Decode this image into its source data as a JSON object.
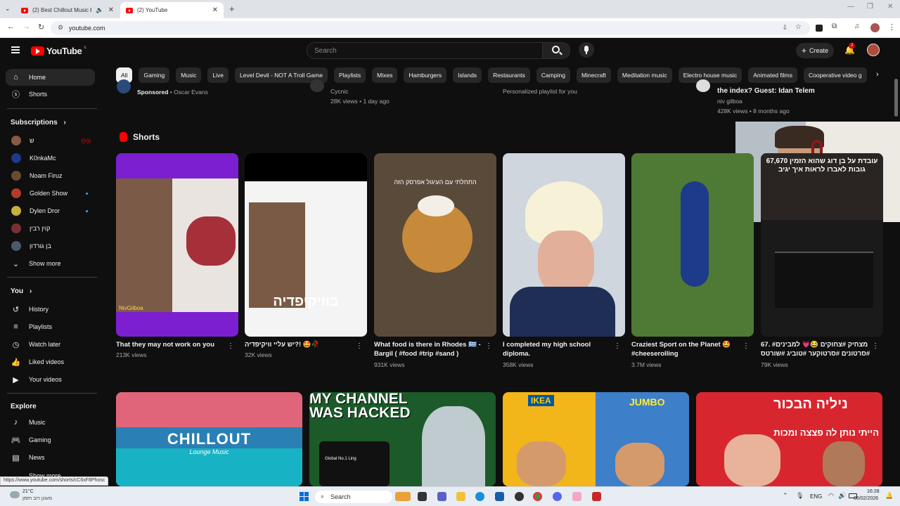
{
  "browser": {
    "tabs": [
      {
        "label": "(2) Best Chillout Music 🎼"
      },
      {
        "label": "(2) YouTube"
      }
    ],
    "url": "youtube.com",
    "status_url": "https://www.youtube.com/shorts/cC6xF8Phosc"
  },
  "masthead": {
    "logo": "YouTube",
    "logo_region": "IL",
    "search_placeholder": "Search",
    "create_label": "Create",
    "notifications_count": "2"
  },
  "chips": [
    "All",
    "Gaming",
    "Music",
    "Live",
    "Level Devil - NOT A Troll Game",
    "Playlists",
    "Mixes",
    "Hamburgers",
    "Islands",
    "Restaurants",
    "Camping",
    "Minecraft",
    "Meditation music",
    "Electro house music",
    "Animated films",
    "Cooperative video g"
  ],
  "sidebar": {
    "home": "Home",
    "shorts": "Shorts",
    "subscriptions_header": "Subscriptions",
    "subscriptions": [
      {
        "name": "ש",
        "color": "#8a5a44"
      },
      {
        "name": "K0nkaMc",
        "color": "#1e3a8a"
      },
      {
        "name": "Noam Firuz",
        "color": "#6b4a2f"
      },
      {
        "name": "Golden Show",
        "color": "#b43a2a"
      },
      {
        "name": "Dylen Dror",
        "color": "#c9b03a"
      },
      {
        "name": "קוין רבין",
        "color": "#7a3030"
      },
      {
        "name": "בן גורדון",
        "color": "#4a5a6a"
      }
    ],
    "show_more": "Show more",
    "you_header": "You",
    "you_items": [
      "History",
      "Playlists",
      "Watch later",
      "Liked videos",
      "Your videos"
    ],
    "explore_header": "Explore",
    "explore_items": [
      "Music",
      "Gaming",
      "News"
    ],
    "show_more_2": "Show more"
  },
  "top_row": [
    {
      "line1": "Sponsored",
      "line2": "Oscar Evans"
    },
    {
      "channel": "Cycnic",
      "meta": "28K views • 1 day ago"
    },
    {
      "meta": "Personalized playlist for you"
    },
    {
      "title": "the index? Guest: Idan Telem",
      "channel": "niv gilboa",
      "meta": "428K views • 8 months ago"
    }
  ],
  "shorts_header": "Shorts",
  "shorts": [
    {
      "title": "That they may not work on you",
      "views": "213K views",
      "bg": "#7b1fd1",
      "overlay": "NivGilboa"
    },
    {
      "title": "יש עליי וויקיפדיה?! 🤩🥀",
      "views": "32K views",
      "bg": "#f4f4f4",
      "overlay": "בוויקיפדיה"
    },
    {
      "title": "What food is there in Rhodes 🇬🇷 - Bargil ( #food #trip #sand )",
      "views": "931K views",
      "bg": "#5a4a3a",
      "overlay": "התחלתי עם העיגול אפרסק הזה"
    },
    {
      "title": "I completed my high school diploma.",
      "views": "358K views",
      "bg": "#cfd6dd",
      "overlay": ""
    },
    {
      "title": "Craziest Sport on the Planet 🤩 #cheeserolling",
      "views": "3.7M views",
      "bg": "#4f7a35",
      "overlay": ""
    },
    {
      "title": "67. #מצחיק #צחוקים 😂💗 למבינים #סרטונים #סרטוקער #טוביג #שורטס",
      "views": "79K views",
      "bg": "#1a1a1a",
      "overlay": "עובדת על בן דוג שהוא הזמין 67,670 גובות לאברו לראות איך יגיב"
    }
  ],
  "videos": [
    {
      "title_art": "CHILLOUT",
      "sub_art": "Lounge Music",
      "bg": "#2a7fb5"
    },
    {
      "title_art": "MY CHANNEL WAS HACKED",
      "sub_art": "Global No.1 Ling",
      "bg": "#1c5a2a"
    },
    {
      "title_art": "IKEA",
      "sub_art": "JUMBO",
      "bg": "#f2b51a"
    },
    {
      "title_art": "ניליה הבכור",
      "sub_art": "הייתי נותן לה פצצה ומכות",
      "bg": "#d8262f"
    }
  ],
  "taskbar": {
    "weather_temp": "21°C",
    "weather_desc": "מעונן רוב הזמן",
    "search_label": "Search",
    "lang": "ENG",
    "time": "16:28",
    "date": "06/02/2026"
  },
  "colors": {
    "accent": "#ff0000",
    "bg": "#0f0f0f",
    "chip_selected": "#f1f1f1",
    "link": "#3ea6ff"
  }
}
